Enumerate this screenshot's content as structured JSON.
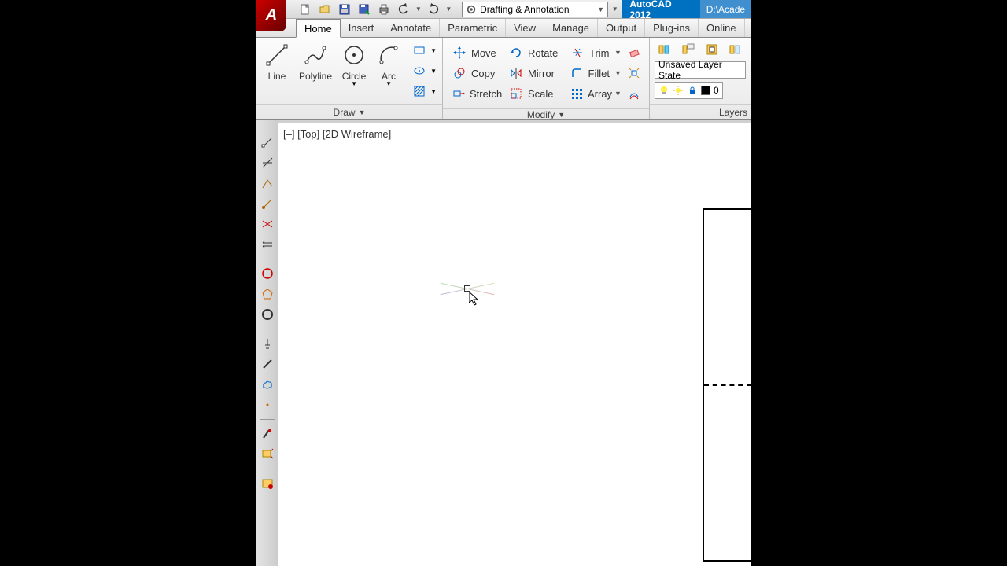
{
  "titlebar": {
    "workspace": "Drafting & Annotation",
    "product": "AutoCAD 2012",
    "file": "D:\\Acade"
  },
  "tabs": {
    "home": "Home",
    "insert": "Insert",
    "annotate": "Annotate",
    "parametric": "Parametric",
    "view": "View",
    "manage": "Manage",
    "output": "Output",
    "plugins": "Plug-ins",
    "online": "Online"
  },
  "draw": {
    "line": "Line",
    "polyline": "Polyline",
    "circle": "Circle",
    "arc": "Arc",
    "panel": "Draw"
  },
  "modify": {
    "move": "Move",
    "copy": "Copy",
    "stretch": "Stretch",
    "rotate": "Rotate",
    "mirror": "Mirror",
    "scale": "Scale",
    "trim": "Trim",
    "fillet": "Fillet",
    "array": "Array",
    "panel": "Modify"
  },
  "layers": {
    "state": "Unsaved Layer State",
    "current": "0",
    "panel": "Layers"
  },
  "viewport": {
    "label": "[–] [Top] [2D Wireframe]"
  }
}
